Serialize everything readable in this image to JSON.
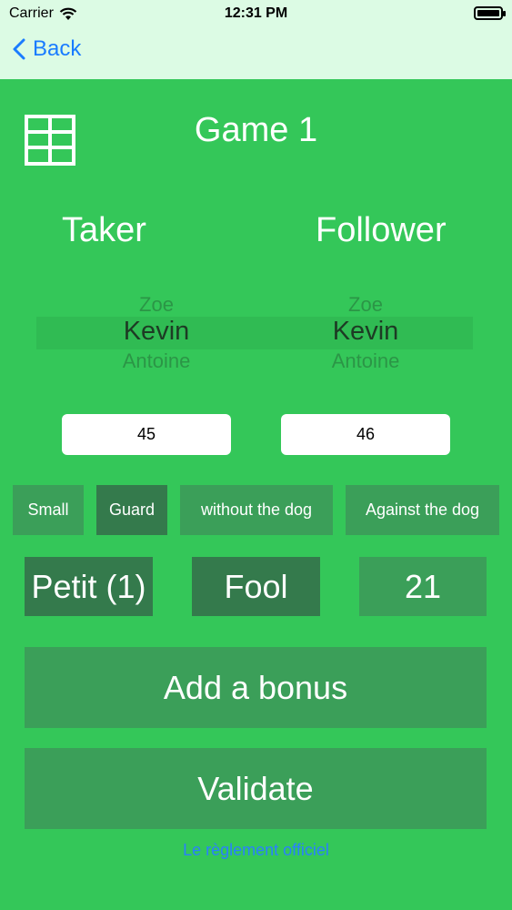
{
  "status": {
    "carrier": "Carrier",
    "time": "12:31 PM"
  },
  "nav": {
    "back_label": "Back"
  },
  "game": {
    "title": "Game 1"
  },
  "taker": {
    "label": "Taker",
    "above": "Zoe",
    "selected": "Kevin",
    "below": "Antoine",
    "score": "45"
  },
  "follower": {
    "label": "Follower",
    "above": "Zoe",
    "selected": "Kevin",
    "below": "Antoine",
    "score": "46"
  },
  "contracts": [
    "Small",
    "Guard",
    "without the dog",
    "Against the dog"
  ],
  "oudlers": {
    "petit": "Petit (1)",
    "fool": "Fool",
    "twenty_one": "21"
  },
  "actions": {
    "add_bonus": "Add a bonus",
    "validate": "Validate"
  },
  "rules_link": "Le règlement officiel",
  "colors": {
    "background": "#34c759",
    "topbar": "#dcfbe4",
    "tile": "#3b9f59",
    "tile_active": "#347a4c",
    "link": "#1a7cff"
  }
}
